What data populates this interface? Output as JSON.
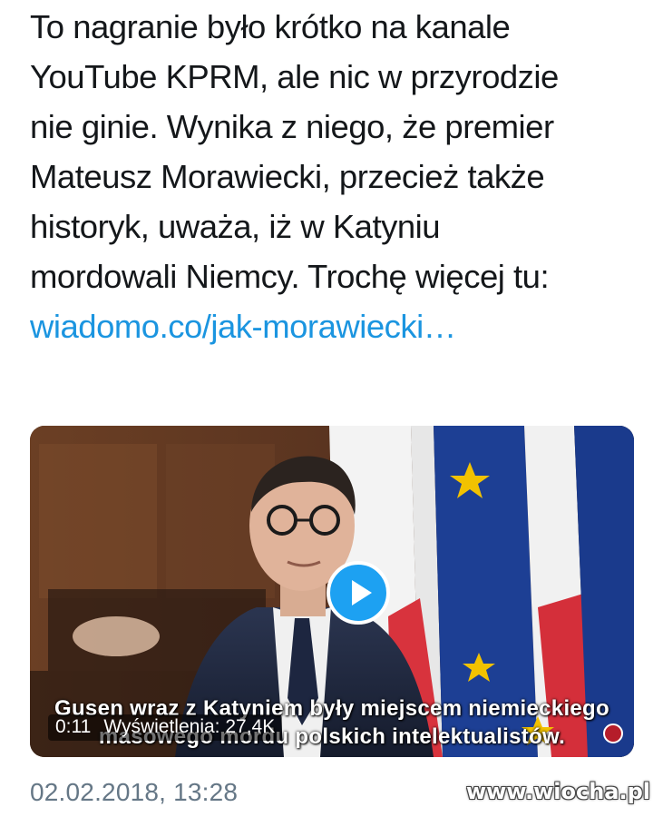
{
  "tweet": {
    "text_lines": [
      "To nagranie było krótko na kanale",
      "YouTube KPRM, ale nic w przyrodzie",
      "nie ginie. Wynika z niego, że premier",
      "Mateusz Morawiecki, przecież także",
      "historyk, uważa, iż w Katyniu",
      "mordowali Niemcy. Trochę więcej tu:"
    ],
    "link_text": "wiadomo.co/jak-morawiecki…",
    "timestamp": "02.02.2018, 13:28"
  },
  "video": {
    "subtitle_line1": "Gusen wraz z Katyniem były miejscem niemieckiego",
    "subtitle_line2": "masowego mordu polskich intelektualistów.",
    "duration": "0:11",
    "views": "Wyświetlenia: 27,4K",
    "play_icon": "play-icon"
  },
  "watermark": "www.wiocha.pl",
  "colors": {
    "link": "#1b95e0",
    "text": "#14171a",
    "meta": "#657786",
    "play_button": "#1da1f2"
  }
}
